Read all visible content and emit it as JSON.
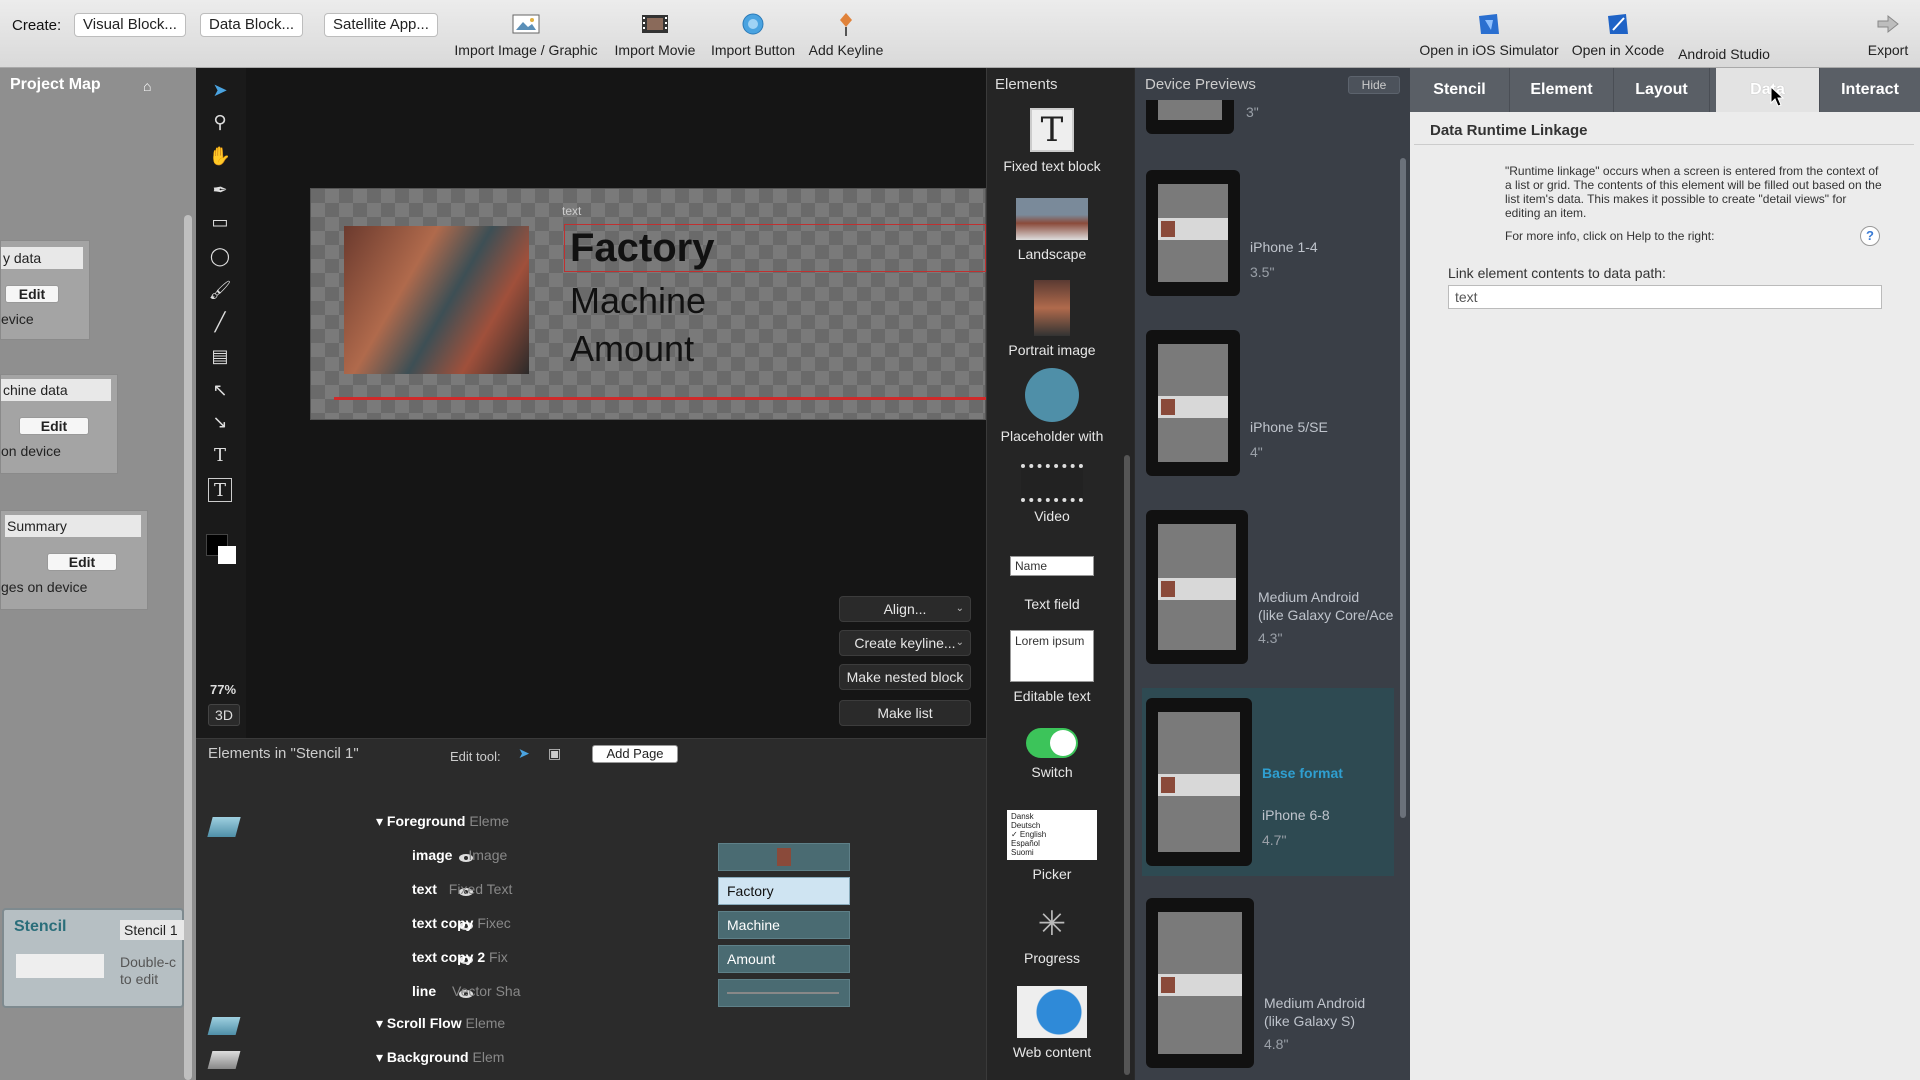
{
  "toolbar": {
    "create_label": "Create:",
    "create_buttons": [
      "Visual Block...",
      "Data Block...",
      "Satellite App..."
    ],
    "tools": [
      "Import Image / Graphic",
      "Import Movie",
      "Import Button",
      "Add Keyline"
    ],
    "right_tools": [
      "Open in iOS Simulator",
      "Open in Xcode",
      "Android Studio",
      "Export"
    ]
  },
  "project_map": {
    "title": "Project Map",
    "cards": [
      {
        "field": "y data",
        "edit": "Edit",
        "sub": "evice"
      },
      {
        "field": "chine data",
        "edit": "Edit",
        "sub": "on device"
      },
      {
        "field": "Summary",
        "edit": "Edit",
        "sub": "ges on device"
      }
    ],
    "stencil_card": {
      "title": "Stencil",
      "name": "Stencil 1",
      "hint": "Double-c\nto edit"
    }
  },
  "canvas": {
    "selection_label": "text",
    "line1": "Factory",
    "line2": "Machine",
    "line3": "Amount",
    "zoom": "77%",
    "mode_3d": "3D",
    "buttons": {
      "align": "Align...",
      "create_keyline": "Create keyline...",
      "make_nested": "Make nested block",
      "make_list": "Make list"
    }
  },
  "element_list": {
    "title": "Elements in \"Stencil 1\"",
    "edit_tool_label": "Edit tool:",
    "add_page": "Add Page",
    "groups": {
      "foreground": {
        "name": "Foreground",
        "type": "Eleme"
      },
      "scroll": {
        "name": "Scroll Flow",
        "type": "Eleme"
      },
      "background": {
        "name": "Background",
        "type": "Elem"
      }
    },
    "rows": [
      {
        "name": "image",
        "type": "Image",
        "value": ""
      },
      {
        "name": "text",
        "type": "Fixed Text",
        "value": "Factory"
      },
      {
        "name": "text copy",
        "type": "Fixec",
        "value": "Machine"
      },
      {
        "name": "text copy 2",
        "type": "Fix",
        "value": "Amount"
      },
      {
        "name": "line",
        "type": "Vector Sha",
        "value": ""
      }
    ]
  },
  "library": {
    "title": "Elements",
    "items": [
      "Fixed text block",
      "Landscape",
      "Portrait image",
      "Placeholder with",
      "Video",
      "Text field",
      "Editable text",
      "Switch",
      "Picker",
      "Progress",
      "Web content"
    ],
    "text_field_placeholder": "Name",
    "editable_sample": "Lorem ipsum",
    "picker_options": [
      "Dansk",
      "Deutsch",
      "✓ English",
      "Español",
      "Suomi"
    ]
  },
  "devices": {
    "title": "Device Previews",
    "hide": "Hide",
    "top_size": "3\"",
    "list": [
      {
        "name": "iPhone 1-4",
        "size": "3.5\""
      },
      {
        "name": "iPhone 5/SE",
        "size": "4\""
      },
      {
        "name": "Medium Android\n(like Galaxy Core/Ace",
        "size": "4.3\""
      },
      {
        "name": "iPhone 6-8",
        "size": "4.7\"",
        "badge": "Base format"
      },
      {
        "name": "Medium Android\n(like Galaxy S)",
        "size": "4.8\""
      }
    ]
  },
  "inspector": {
    "tabs": [
      "Stencil",
      "Element",
      "Layout",
      "Data",
      "Interact"
    ],
    "active_tab": "Data",
    "title": "Data Runtime Linkage",
    "description": "\"Runtime linkage\" occurs when a screen is entered from the context of a list or grid. The contents of this element will be filled out based on the list item's data. This makes it possible to create \"detail views\" for editing an item.",
    "more_info": "For more info, click on Help to the right:",
    "help": "?",
    "link_label": "Link element contents to data path:",
    "link_value": "text"
  },
  "colors": {
    "accent": "#2f9fd0",
    "selection_red": "#d02a2a",
    "switch_green": "#3cc45a"
  }
}
